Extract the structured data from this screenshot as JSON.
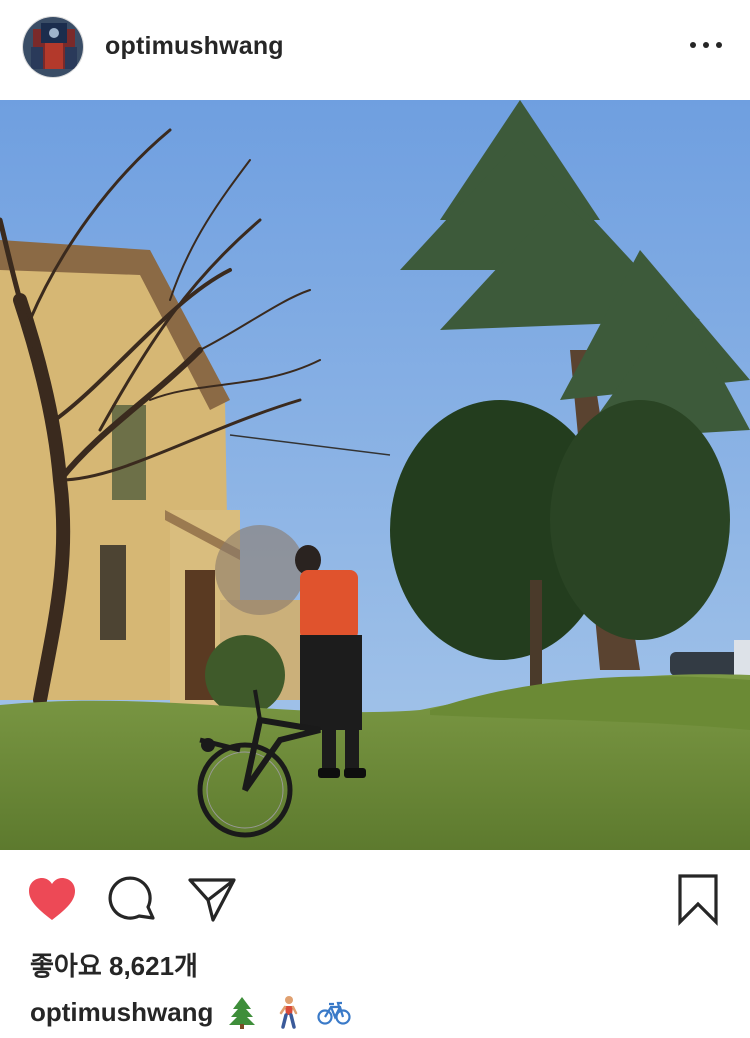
{
  "post": {
    "username": "optimushwang",
    "likes_text": "좋아요 8,621개",
    "caption_username": "optimushwang",
    "caption_emojis": [
      "tree-icon",
      "person-walking-icon",
      "bicycle-icon"
    ]
  },
  "actions": {
    "like": "heart-icon",
    "comment": "comment-icon",
    "share": "send-icon",
    "save": "bookmark-icon"
  },
  "colors": {
    "like_red": "#ed4956",
    "text": "#262626"
  }
}
